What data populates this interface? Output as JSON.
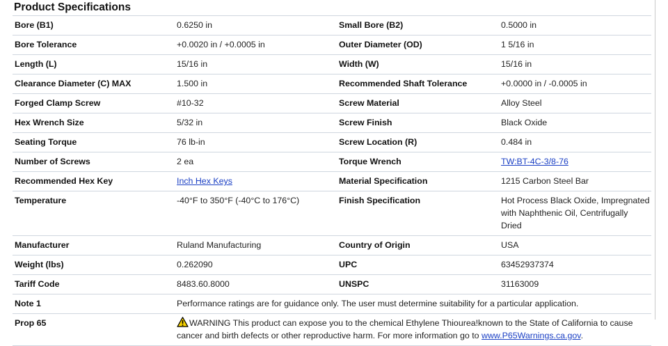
{
  "title": "Product Specifications",
  "rows": [
    {
      "l1": "Bore (B1)",
      "v1": "0.6250 in",
      "l2": "Small Bore (B2)",
      "v2": "0.5000 in"
    },
    {
      "l1": "Bore Tolerance",
      "v1": "+0.0020 in / +0.0005 in",
      "l2": "Outer Diameter (OD)",
      "v2": "1 5/16 in"
    },
    {
      "l1": "Length (L)",
      "v1": "15/16 in",
      "l2": "Width (W)",
      "v2": "15/16 in"
    },
    {
      "l1": "Clearance Diameter (C) MAX",
      "v1": "1.500 in",
      "l2": "Recommended Shaft Tolerance",
      "v2": "+0.0000 in / -0.0005 in"
    },
    {
      "l1": "Forged Clamp Screw",
      "v1": "#10-32",
      "l2": "Screw Material",
      "v2": "Alloy Steel"
    },
    {
      "l1": "Hex Wrench Size",
      "v1": "5/32 in",
      "l2": "Screw Finish",
      "v2": "Black Oxide"
    },
    {
      "l1": "Seating Torque",
      "v1": "76 lb-in",
      "l2": "Screw Location (R)",
      "v2": "0.484 in"
    },
    {
      "l1": "Number of Screws",
      "v1": "2 ea",
      "l2": "Torque Wrench",
      "v2": "TW:BT-4C-3/8-76"
    },
    {
      "l1": "Recommended Hex Key",
      "v1": "Inch Hex Keys",
      "l2": "Material Specification",
      "v2": "1215 Carbon Steel Bar"
    },
    {
      "l1": "Temperature",
      "v1": "-40°F to 350°F (-40°C to 176°C)",
      "l2": "Finish Specification",
      "v2": "Hot Process Black Oxide, Impregnated with Naphthenic Oil, Centrifugally Dried"
    },
    {
      "l1": "Manufacturer",
      "v1": "Ruland Manufacturing",
      "l2": "Country of Origin",
      "v2": "USA"
    },
    {
      "l1": "Weight (lbs)",
      "v1": "0.262090",
      "l2": "UPC",
      "v2": "63452937374"
    },
    {
      "l1": "Tariff Code",
      "v1": "8483.60.8000",
      "l2": "UNSPC",
      "v2": "31163009"
    }
  ],
  "note1": {
    "label": "Note 1",
    "text": "Performance ratings are for guidance only. The user must determine suitability for a particular application."
  },
  "prop65": {
    "label": "Prop 65",
    "text": "WARNING This product can expose you to the chemical Ethylene Thiourea!known to the State of California to cause cancer and birth defects or other reproductive harm. For more information go to ",
    "link": "www.P65Warnings.ca.gov",
    "after": ".",
    "icon": "warning-triangle-icon"
  },
  "colors": {
    "link": "#1a3fc4",
    "rule": "#cfd6df"
  }
}
